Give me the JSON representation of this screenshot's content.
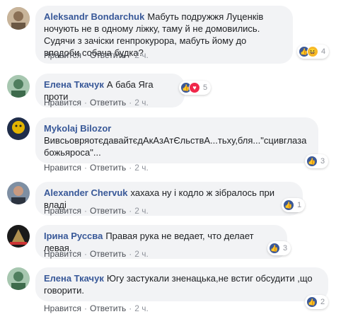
{
  "actions": {
    "like": "Нравится",
    "reply": "Ответить",
    "sep": "·"
  },
  "colors": {
    "author": "#385898",
    "bubble": "#f2f3f5",
    "like": "#3b5998",
    "love": "#f0284a",
    "haha": "#f7b928"
  },
  "comments": [
    {
      "author": "Aleksandr Bondarchuk",
      "text": "Мабуть подружжя Луценків ночують не в одному ліжку, таму й не домовились. Судячи з зачіски генпрокурора, мабуть йому до вподоби собача будка?",
      "time": "2 ч.",
      "reactions": [
        "like-icon",
        "haha-icon"
      ],
      "count": "4"
    },
    {
      "author": "Елена Ткачук",
      "text": "А баба Яга проти",
      "time": "2 ч.",
      "reactions": [
        "like-icon",
        "love-icon"
      ],
      "count": "5"
    },
    {
      "author": "Mykolaj Bilozor",
      "text": "ВивсьовряотєдавайтєдАкАзАтЄльствА...тьху,бля...\"сцивглазабожьяроса\"...",
      "time": "2 ч.",
      "reactions": [
        "like-icon"
      ],
      "count": "3"
    },
    {
      "author": "Alexander Chervuk",
      "text": "хахаха ну і кодло ж зібралось при владі",
      "time": "2 ч.",
      "reactions": [
        "like-icon"
      ],
      "count": "1"
    },
    {
      "author": "Ірина Руссва",
      "text": "Правая рука не ведает, что делает левая.",
      "time": "2 ч.",
      "reactions": [
        "like-icon"
      ],
      "count": "3"
    },
    {
      "author": "Елена Ткачук",
      "text": "Югу застукали зненацька,не встиг обсудити ,що говорити.",
      "time": "2 ч.",
      "reactions": [
        "like-icon"
      ],
      "count": "2"
    }
  ]
}
